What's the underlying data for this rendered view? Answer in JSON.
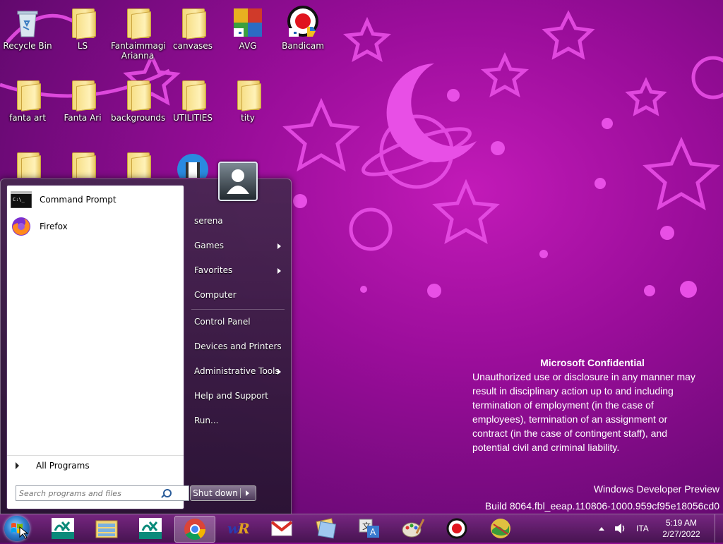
{
  "desktop": {
    "icons": [
      {
        "label": "Recycle Bin"
      },
      {
        "label": "LS"
      },
      {
        "label": "Fantaimmagi Arianna"
      },
      {
        "label": "canvases"
      },
      {
        "label": "AVG"
      },
      {
        "label": "Bandicam"
      },
      {
        "label": "fanta art"
      },
      {
        "label": "Fanta Ari"
      },
      {
        "label": "backgrounds"
      },
      {
        "label": "UTILITIES"
      },
      {
        "label": "tity"
      }
    ]
  },
  "start_menu": {
    "pinned": [
      {
        "label": "Command Prompt",
        "icon": "command-prompt-icon"
      },
      {
        "label": "Firefox",
        "icon": "firefox-icon"
      }
    ],
    "all_programs": "All Programs",
    "search_placeholder": "Search programs and files",
    "right": {
      "user": "serena",
      "games": "Games",
      "favorites": "Favorites",
      "computer": "Computer",
      "control_panel": "Control Panel",
      "devices": "Devices and Printers",
      "admin_tools": "Administrative Tools",
      "help": "Help and Support",
      "run": "Run..."
    },
    "shutdown": "Shut down"
  },
  "notice": {
    "title": "Microsoft Confidential",
    "lines": [
      "Unauthorized use or disclosure in any manner may",
      "result in disciplinary action up to and including",
      "termination of employment (in the case of",
      "employees), termination of an assignment or",
      "contract (in the case of contingent staff), and",
      "potential civil and criminal liability."
    ],
    "edition": "Windows Developer Preview",
    "build": "Build 8064.fbl_eeap.110806-1000.959cf95e18056cd0"
  },
  "taskbar": {
    "apps": [
      {
        "name": "credit-agricole-icon"
      },
      {
        "name": "file-explorer-icon"
      },
      {
        "name": "credit-agricole-icon"
      },
      {
        "name": "chrome-icon",
        "active": true
      },
      {
        "name": "wr-icon"
      },
      {
        "name": "gmail-icon"
      },
      {
        "name": "folders-icon"
      },
      {
        "name": "translate-icon"
      },
      {
        "name": "paint-icon"
      },
      {
        "name": "bandicam-icon"
      },
      {
        "name": "map-icon"
      }
    ],
    "lang": "ITA",
    "time": "5:19 AM",
    "date": "2/27/2022"
  },
  "colors": {
    "wallpaper": "#a012a8",
    "accent": "#e04fe0"
  }
}
